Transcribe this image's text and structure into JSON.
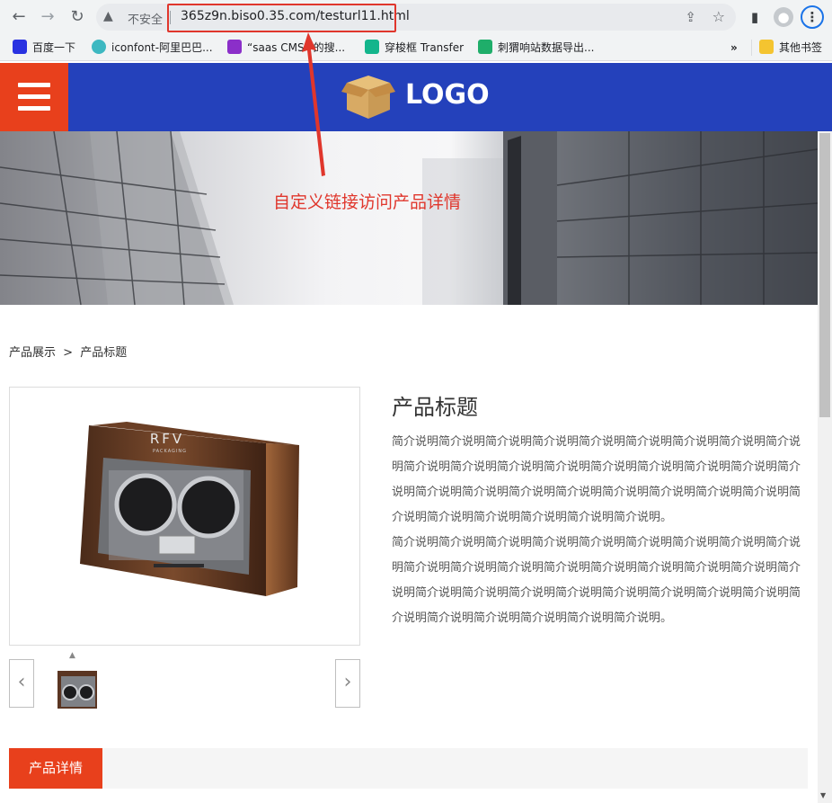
{
  "browser": {
    "back_icon": "arrow-left-icon",
    "forward_icon": "arrow-right-icon",
    "reload_icon": "reload-icon",
    "security_label": "不安全",
    "url": "365z9n.biso0.35.com/testurl11.html"
  },
  "bookmarks": [
    {
      "label": "百度一下",
      "color": "#2932e1"
    },
    {
      "label": "iconfont-阿里巴巴...",
      "color": "#3db8c1"
    },
    {
      "label": "“saas CMS” 的搜...",
      "color": "#8b2fc9"
    },
    {
      "label": "穿梭框 Transfer",
      "color": "#13b58c"
    },
    {
      "label": "刺猬响站数据导出...",
      "color": "#1fae6a"
    }
  ],
  "bookmarks_more": "»",
  "bookmarks_other": "其他书签",
  "header": {
    "logo_text": "LOGO",
    "bg_color": "#2441bb",
    "accent_color": "#e8401c"
  },
  "banner": {
    "annotation": "自定义链接访问产品详情"
  },
  "breadcrumb": {
    "root": "产品展示",
    "separator": ">",
    "current": "产品标题"
  },
  "product": {
    "image_brand_text": "RFV",
    "image_brand_sub": "PACKAGING",
    "title": "产品标题",
    "desc_1": "简介说明简介说明简介说明简介说明简介说明简介说明简介说明简介说明简介说明简介说明简介说明简介说明简介说明简介说明简介说明简介说明简介说明简介说明简介说明简介说明简介说明简介说明简介说明简介说明简介说明简介说明简介说明简介说明简介说明简介说明简介说明简介说明。",
    "desc_2": "简介说明简介说明简介说明简介说明简介说明简介说明简介说明简介说明简介说明简介说明简介说明简介说明简介说明简介说明简介说明简介说明简介说明简介说明简介说明简介说明简介说明简介说明简介说明简介说明简介说明简介说明简介说明简介说明简介说明简介说明简介说明简介说明。"
  },
  "thumbs": {
    "prev_label": "‹",
    "next_label": "›",
    "caret": "▲"
  },
  "detail": {
    "tab_label": "产品详情"
  }
}
